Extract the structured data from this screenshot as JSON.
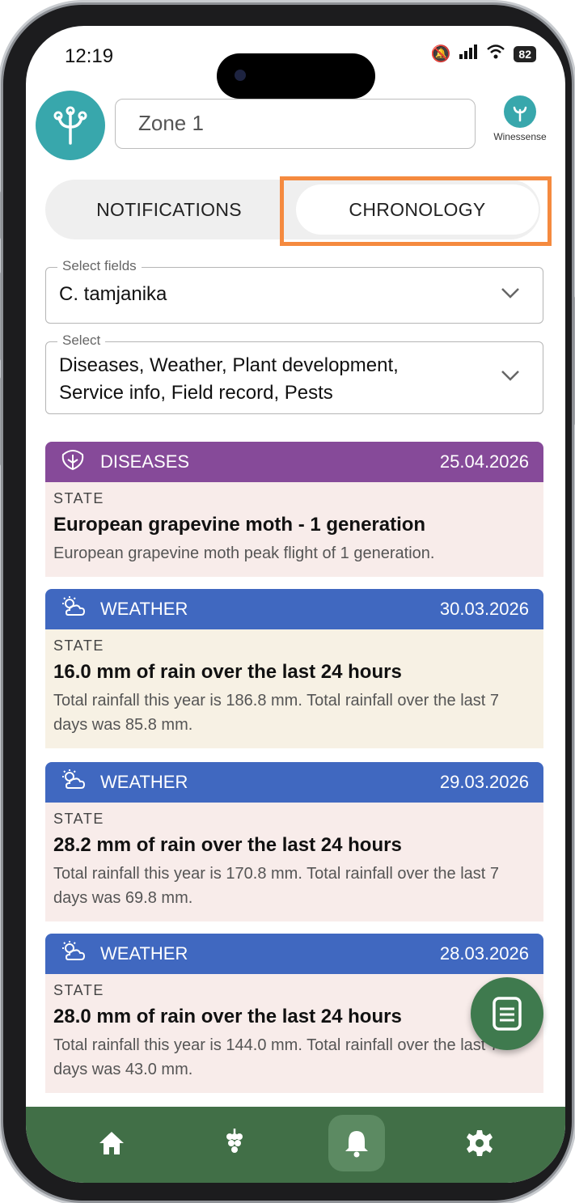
{
  "status_bar": {
    "time": "12:19",
    "battery": "82"
  },
  "header": {
    "zone": "Zone 1",
    "brand": "Winessense"
  },
  "tabs": [
    {
      "label": "NOTIFICATIONS",
      "active": false
    },
    {
      "label": "CHRONOLOGY",
      "active": true
    }
  ],
  "filters": {
    "fields": {
      "legend": "Select fields",
      "value": "C. tamjanika"
    },
    "types": {
      "legend": "Select",
      "value": "Diseases, Weather, Plant development, Service info, Field record, Pests"
    }
  },
  "cards": [
    {
      "category": "DISEASES",
      "date": "25.04.2026",
      "state": "STATE",
      "title": "European grapevine moth - 1 generation",
      "description": "European grapevine moth peak flight of 1 generation.",
      "color": "#864a99"
    },
    {
      "category": "WEATHER",
      "date": "30.03.2026",
      "state": "STATE",
      "title": "16.0 mm of rain over the last 24 hours",
      "description": "Total rainfall this year is 186.8 mm. Total rainfall over the last 7 days was 85.8 mm.",
      "color": "#4068c0"
    },
    {
      "category": "WEATHER",
      "date": "29.03.2026",
      "state": "STATE",
      "title": "28.2 mm of rain over the last 24 hours",
      "description": "Total rainfall this year is 170.8 mm. Total rainfall over the last 7 days was 69.8 mm.",
      "color": "#4068c0"
    },
    {
      "category": "WEATHER",
      "date": "28.03.2026",
      "state": "STATE",
      "title": "28.0 mm of rain over the last 24 hours",
      "description": "Total rainfall this year is 144.0 mm. Total rainfall over the last 7 days was 43.0 mm.",
      "color": "#4068c0"
    }
  ],
  "nav": [
    {
      "icon": "home-icon",
      "active": false
    },
    {
      "icon": "grape-icon",
      "active": false
    },
    {
      "icon": "bell-icon",
      "active": true
    },
    {
      "icon": "gear-icon",
      "active": false
    }
  ],
  "colors": {
    "accent_highlight": "#f58a3f",
    "nav_bg": "#416f47",
    "brand_teal": "#38a7ac"
  }
}
